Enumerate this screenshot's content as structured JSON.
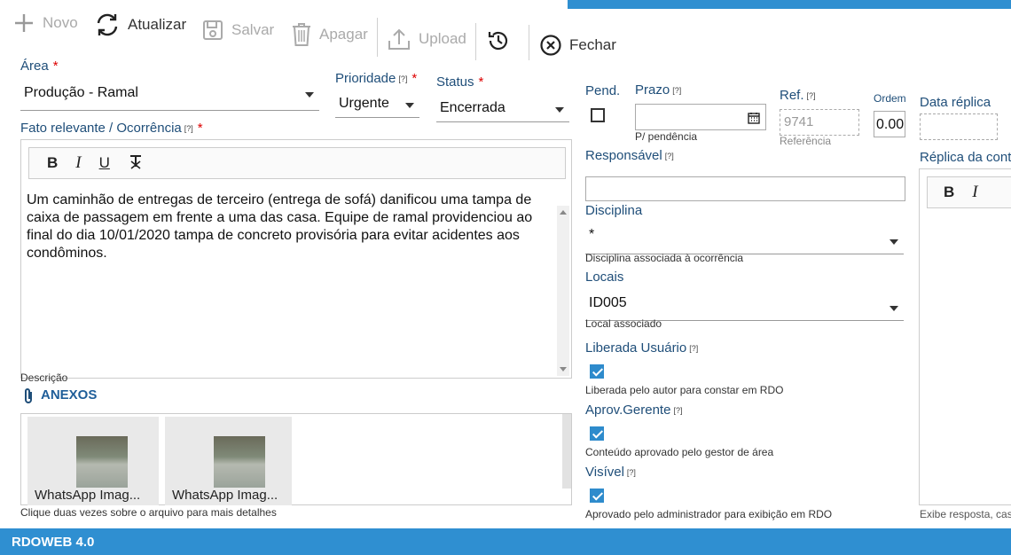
{
  "toolbar": {
    "novo": "Novo",
    "atualizar": "Atualizar",
    "salvar": "Salvar",
    "apagar": "Apagar",
    "upload": "Upload",
    "fechar": "Fechar"
  },
  "form": {
    "area": {
      "label": "Área",
      "value": "Produção - Ramal"
    },
    "prioridade": {
      "label": "Prioridade",
      "value": "Urgente"
    },
    "status": {
      "label": "Status",
      "value": "Encerrada"
    },
    "fato": {
      "label": "Fato relevante / Ocorrência"
    },
    "editor_text": "Um caminhão de entregas de terceiro (entrega de sofá) danificou uma tampa de caixa de passagem em frente a uma das casa. Equipe de ramal providenciou ao final do dia 10/01/2020 tampa de concreto provisória para evitar acidentes aos condôminos.",
    "descricao_hint": "Descrição",
    "anexos_title": "ANEXOS",
    "attachments": [
      {
        "name": "WhatsApp Imag..."
      },
      {
        "name": "WhatsApp Imag..."
      }
    ],
    "anexos_hint": "Clique duas vezes sobre o arquivo para mais detalhes",
    "pend": {
      "label": "Pend."
    },
    "prazo": {
      "label": "Prazo",
      "hint": "P/ pendência"
    },
    "ref": {
      "label": "Ref.",
      "placeholder": "9741",
      "hint": "Referência"
    },
    "ordem": {
      "label": "Ordem",
      "value": "0.00"
    },
    "data_replica": {
      "label": "Data réplica"
    },
    "responsavel": {
      "label": "Responsável"
    },
    "replica": {
      "label": "Réplica da contra",
      "hint": "Exibe resposta, caso"
    },
    "disciplina": {
      "label": "Disciplina",
      "value": "*",
      "hint": "Disciplina associada à ocorrência"
    },
    "locais": {
      "label": "Locais",
      "value": "ID005",
      "hint": "Local associado"
    },
    "liberada": {
      "label": "Liberada Usuário",
      "hint": "Liberada pelo autor para constar em RDO"
    },
    "aprov": {
      "label": "Aprov.Gerente",
      "hint": "Conteúdo aprovado pelo gestor de área"
    },
    "visivel": {
      "label": "Visível",
      "hint": "Aprovado pelo administrador para exibição em RDO"
    },
    "help_mark": "[?]",
    "req_mark": "*"
  },
  "footer": {
    "app": "RDOWEB 4.0"
  }
}
